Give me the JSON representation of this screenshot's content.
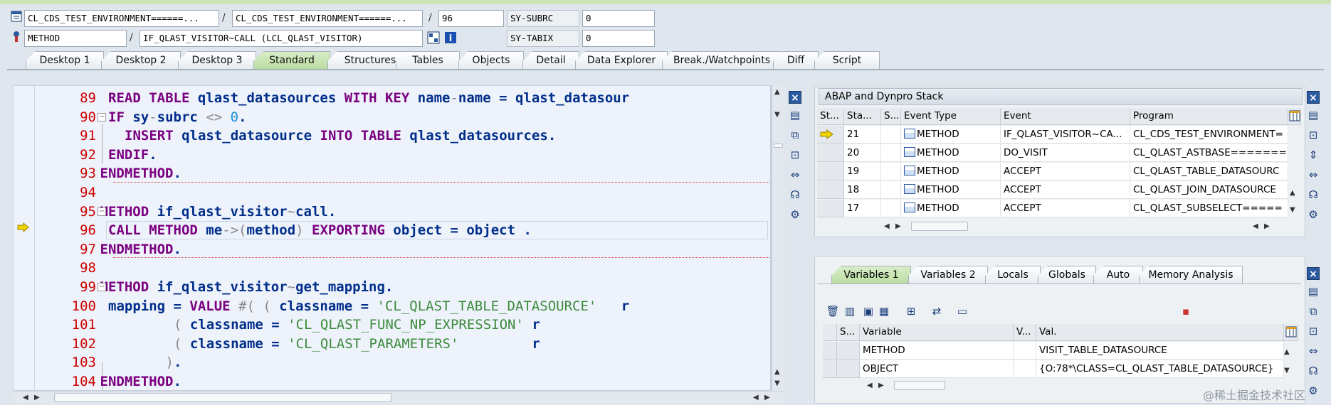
{
  "header": {
    "row1": {
      "program": "CL_CDS_TEST_ENVIRONMENT======...",
      "include": "CL_CDS_TEST_ENVIRONMENT======...",
      "line": "96",
      "sysvar_label": "SY-SUBRC",
      "sysvar_value": "0"
    },
    "row2": {
      "event_type": "METHOD",
      "event": "IF_QLAST_VISITOR~CALL (LCL_QLAST_VISITOR)",
      "sysvar_label": "SY-TABIX",
      "sysvar_value": "0"
    },
    "separator": "/"
  },
  "tabs": [
    "Desktop 1",
    "Desktop 2",
    "Desktop 3",
    "Standard",
    "Structures",
    "Tables",
    "Objects",
    "Detail",
    "Data Explorer",
    "Break./Watchpoints",
    "Diff",
    "Script"
  ],
  "active_tab": "Standard",
  "code": {
    "lines": [
      {
        "no": "89",
        "segments": [
          [
            "kw",
            "READ TABLE "
          ],
          [
            "n",
            "qlast_datasources "
          ],
          [
            "kw",
            "WITH KEY "
          ],
          [
            "n",
            "name"
          ],
          [
            "sym",
            "-"
          ],
          [
            "n",
            "name = qlast_datasour"
          ]
        ]
      },
      {
        "no": "90",
        "segments": [
          [
            "kw",
            "IF "
          ],
          [
            "n",
            "sy"
          ],
          [
            "sym",
            "-"
          ],
          [
            "n",
            "subrc "
          ],
          [
            "sym",
            "<> "
          ],
          [
            "num",
            "0"
          ],
          [
            "n",
            "."
          ]
        ]
      },
      {
        "no": "91",
        "segments": [
          [
            "kw",
            "INSERT "
          ],
          [
            "n",
            "qlast_datasource "
          ],
          [
            "kw",
            "INTO TABLE "
          ],
          [
            "n",
            "qlast_datasources."
          ]
        ]
      },
      {
        "no": "92",
        "segments": [
          [
            "kw",
            "ENDIF"
          ],
          [
            "n",
            "."
          ]
        ]
      },
      {
        "no": "93",
        "segments": [
          [
            "kw",
            "ENDMETHOD"
          ],
          [
            "n",
            "."
          ]
        ]
      },
      {
        "no": "94",
        "segments": []
      },
      {
        "no": "95",
        "segments": [
          [
            "kw",
            "METHOD "
          ],
          [
            "n",
            "if_qlast_visitor"
          ],
          [
            "sym",
            "~"
          ],
          [
            "n",
            "call."
          ]
        ]
      },
      {
        "no": "96",
        "segments": [
          [
            "kw",
            "CALL METHOD "
          ],
          [
            "n",
            "me"
          ],
          [
            "sym",
            "->("
          ],
          [
            "n",
            "method"
          ],
          [
            "sym",
            ") "
          ],
          [
            "kw",
            "EXPORTING "
          ],
          [
            "n",
            "object = object ."
          ]
        ]
      },
      {
        "no": "97",
        "segments": [
          [
            "kw",
            "ENDMETHOD"
          ],
          [
            "n",
            "."
          ]
        ]
      },
      {
        "no": "98",
        "segments": []
      },
      {
        "no": "99",
        "segments": [
          [
            "kw",
            "METHOD "
          ],
          [
            "n",
            "if_qlast_visitor"
          ],
          [
            "sym",
            "~"
          ],
          [
            "n",
            "get_mapping."
          ]
        ]
      },
      {
        "no": "100",
        "segments": [
          [
            "n",
            "mapping = "
          ],
          [
            "kw",
            "VALUE "
          ],
          [
            "sym",
            "#( ( "
          ],
          [
            "n",
            "classname = "
          ],
          [
            "str",
            "'CL_QLAST_TABLE_DATASOURCE'"
          ],
          [
            "n",
            "   r"
          ]
        ]
      },
      {
        "no": "101",
        "segments": [
          [
            "sym",
            "( "
          ],
          [
            "n",
            "classname = "
          ],
          [
            "str",
            "'CL_QLAST_FUNC_NP_EXPRESSION'"
          ],
          [
            "n",
            " r"
          ]
        ]
      },
      {
        "no": "102",
        "segments": [
          [
            "sym",
            "( "
          ],
          [
            "n",
            "classname = "
          ],
          [
            "str",
            "'CL_QLAST_PARAMETERS'"
          ],
          [
            "n",
            "         r"
          ]
        ]
      },
      {
        "no": "103",
        "segments": [
          [
            "sym",
            ")"
          ],
          [
            "n",
            "."
          ]
        ]
      },
      {
        "no": "104",
        "segments": [
          [
            "kw",
            "ENDMETHOD"
          ],
          [
            "n",
            "."
          ]
        ]
      }
    ]
  },
  "stack": {
    "title": "ABAP and Dynpro Stack",
    "columns": [
      "St...",
      "Sta...",
      "S...",
      "Event Type",
      "Event",
      "Program"
    ],
    "rows": [
      {
        "level": "21",
        "event_type": "METHOD",
        "event": "IF_QLAST_VISITOR~CA...",
        "program": "CL_CDS_TEST_ENVIRONMENT="
      },
      {
        "level": "20",
        "event_type": "METHOD",
        "event": "DO_VISIT",
        "program": "CL_QLAST_ASTBASE======="
      },
      {
        "level": "19",
        "event_type": "METHOD",
        "event": "ACCEPT",
        "program": "CL_QLAST_TABLE_DATASOURC"
      },
      {
        "level": "18",
        "event_type": "METHOD",
        "event": "ACCEPT",
        "program": "CL_QLAST_JOIN_DATASOURCE"
      },
      {
        "level": "17",
        "event_type": "METHOD",
        "event": "ACCEPT",
        "program": "CL_QLAST_SUBSELECT====="
      }
    ]
  },
  "variables": {
    "tabs": [
      "Variables 1",
      "Variables 2",
      "Locals",
      "Globals",
      "Auto",
      "Memory Analysis"
    ],
    "active_tab": "Variables 1",
    "columns": [
      "S...",
      "Variable",
      "V...",
      "Val."
    ],
    "rows": [
      {
        "variable": "METHOD",
        "value": "VISIT_TABLE_DATASOURCE"
      },
      {
        "variable": "OBJECT",
        "value": "{O:78*\\CLASS=CL_QLAST_TABLE_DATASOURCE}"
      }
    ]
  },
  "watermark": "@稀土掘金技术社区",
  "colors": {
    "accent_tab": "#c6e3b0",
    "line_number": "#cc0000",
    "keyword": "#7a0080",
    "identifier": "#002e8a",
    "string": "#3c8a3c"
  }
}
